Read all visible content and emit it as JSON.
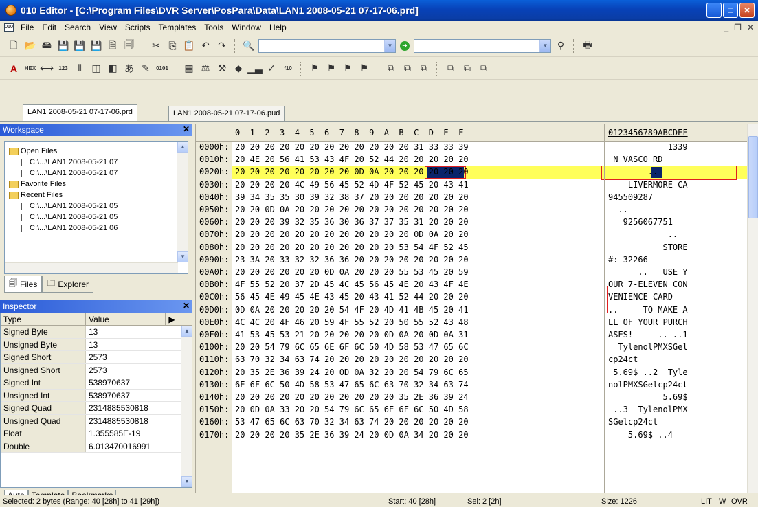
{
  "window": {
    "title": "010 Editor - [C:\\Program Files\\DVR Server\\PosPara\\Data\\LAN1 2008-05-21 07-17-06.prd]"
  },
  "menu": [
    "File",
    "Edit",
    "Search",
    "View",
    "Scripts",
    "Templates",
    "Tools",
    "Window",
    "Help"
  ],
  "toolbar": {
    "icons1": [
      "new-file-icon",
      "open-icon",
      "open-drive-icon",
      "save-icon",
      "save-as-icon",
      "save-all-icon",
      "close-icon",
      "close-all-icon"
    ],
    "icons1b": [
      "cut-icon",
      "copy-icon",
      "paste-icon",
      "undo-icon",
      "redo-icon"
    ],
    "icons1c": [
      "print-icon"
    ],
    "hex_label": "HEX",
    "dec_label": "DEC"
  },
  "file_tabs": [
    "LAN1 2008-05-21 07-17-06.prd",
    "LAN1 2008-05-21 07-17-06.pud"
  ],
  "workspace": {
    "title": "Workspace",
    "tree": [
      {
        "label": "Open Files",
        "type": "folder",
        "indent": 0
      },
      {
        "label": "C:\\...\\LAN1 2008-05-21 07",
        "type": "doc",
        "indent": 1
      },
      {
        "label": "C:\\...\\LAN1 2008-05-21 07",
        "type": "doc",
        "indent": 1
      },
      {
        "label": "Favorite Files",
        "type": "folder",
        "indent": 0
      },
      {
        "label": "Recent Files",
        "type": "folder",
        "indent": 0
      },
      {
        "label": "C:\\...\\LAN1 2008-05-21 05",
        "type": "doc",
        "indent": 1
      },
      {
        "label": "C:\\...\\LAN1 2008-05-21 05",
        "type": "doc",
        "indent": 1
      },
      {
        "label": "C:\\...\\LAN1 2008-05-21 06",
        "type": "doc",
        "indent": 1
      }
    ],
    "tabs": [
      "Files",
      "Explorer"
    ]
  },
  "inspector": {
    "title": "Inspector",
    "col_type": "Type",
    "col_value": "Value",
    "rows": [
      {
        "type": "Signed Byte",
        "value": "13"
      },
      {
        "type": "Unsigned Byte",
        "value": "13"
      },
      {
        "type": "Signed Short",
        "value": "2573"
      },
      {
        "type": "Unsigned Short",
        "value": "2573"
      },
      {
        "type": "Signed Int",
        "value": "538970637"
      },
      {
        "type": "Unsigned Int",
        "value": "538970637"
      },
      {
        "type": "Signed Quad",
        "value": "2314885530818"
      },
      {
        "type": "Unsigned Quad",
        "value": "2314885530818"
      },
      {
        "type": "Float",
        "value": "1.355585E-19"
      },
      {
        "type": "Double",
        "value": "6.013470016991"
      }
    ],
    "tabs": [
      "Auto",
      "Template",
      "Bookmarks"
    ]
  },
  "hex": {
    "header_bytes": "0  1  2  3  4  5  6  7  8  9  A  B  C  D  E  F",
    "header_ascii": "0123456789ABCDEF",
    "rows": [
      {
        "addr": "0000h:",
        "bytes": "20 20 20 20 20 20 20 20 20 20 20 20 31 33 33 39",
        "ascii": "            1339"
      },
      {
        "addr": "0010h:",
        "bytes": "20 4E 20 56 41 53 43 4F 20 52 44 20 20 20 20 20",
        "ascii": " N VASCO RD     "
      },
      {
        "addr": "0020h:",
        "bytes": "20 20 20 20 20 20 20 20 0D 0A 20 20 20 20 20 20",
        "ascii": "        ..      "
      },
      {
        "addr": "0030h:",
        "bytes": "20 20 20 20 4C 49 56 45 52 4D 4F 52 45 20 43 41",
        "ascii": "    LIVERMORE CA"
      },
      {
        "addr": "0040h:",
        "bytes": "39 34 35 35 30 39 32 38 37 20 20 20 20 20 20 20",
        "ascii": "945509287       "
      },
      {
        "addr": "0050h:",
        "bytes": "20 20 0D 0A 20 20 20 20 20 20 20 20 20 20 20 20",
        "ascii": "  ..            "
      },
      {
        "addr": "0060h:",
        "bytes": "20 20 20 39 32 35 36 30 36 37 37 35 31 20 20 20",
        "ascii": "   9256067751   "
      },
      {
        "addr": "0070h:",
        "bytes": "20 20 20 20 20 20 20 20 20 20 20 20 0D 0A 20 20",
        "ascii": "            ..  "
      },
      {
        "addr": "0080h:",
        "bytes": "20 20 20 20 20 20 20 20 20 20 20 53 54 4F 52 45",
        "ascii": "           STORE"
      },
      {
        "addr": "0090h:",
        "bytes": "23 3A 20 33 32 32 36 36 20 20 20 20 20 20 20 20",
        "ascii": "#: 32266        "
      },
      {
        "addr": "00A0h:",
        "bytes": "20 20 20 20 20 20 0D 0A 20 20 20 55 53 45 20 59",
        "ascii": "      ..   USE Y"
      },
      {
        "addr": "00B0h:",
        "bytes": "4F 55 52 20 37 2D 45 4C 45 56 45 4E 20 43 4F 4E",
        "ascii": "OUR 7-ELEVEN CON"
      },
      {
        "addr": "00C0h:",
        "bytes": "56 45 4E 49 45 4E 43 45 20 43 41 52 44 20 20 20",
        "ascii": "VENIENCE CARD   "
      },
      {
        "addr": "00D0h:",
        "bytes": "0D 0A 20 20 20 20 20 54 4F 20 4D 41 4B 45 20 41",
        "ascii": "..     TO MAKE A"
      },
      {
        "addr": "00E0h:",
        "bytes": "4C 4C 20 4F 46 20 59 4F 55 52 20 50 55 52 43 48",
        "ascii": "LL OF YOUR PURCH"
      },
      {
        "addr": "00F0h:",
        "bytes": "41 53 45 53 21 20 20 20 20 20 0D 0A 20 0D 0A 31",
        "ascii": "ASES!     .. ..1"
      },
      {
        "addr": "0100h:",
        "bytes": "20 20 54 79 6C 65 6E 6F 6C 50 4D 58 53 47 65 6C",
        "ascii": "  TylenolPMXSGel"
      },
      {
        "addr": "0110h:",
        "bytes": "63 70 32 34 63 74 20 20 20 20 20 20 20 20 20 20",
        "ascii": "cp24ct          "
      },
      {
        "addr": "0120h:",
        "bytes": "20 35 2E 36 39 24 20 0D 0A 32 20 20 54 79 6C 65",
        "ascii": " 5.69$ ..2  Tyle"
      },
      {
        "addr": "0130h:",
        "bytes": "6E 6F 6C 50 4D 58 53 47 65 6C 63 70 32 34 63 74",
        "ascii": "nolPMXSGelcp24ct"
      },
      {
        "addr": "0140h:",
        "bytes": "20 20 20 20 20 20 20 20 20 20 20 35 2E 36 39 24",
        "ascii": "           5.69$"
      },
      {
        "addr": "0150h:",
        "bytes": "20 0D 0A 33 20 20 54 79 6C 65 6E 6F 6C 50 4D 58",
        "ascii": " ..3  TylenolPMX"
      },
      {
        "addr": "0160h:",
        "bytes": "53 47 65 6C 63 70 32 34 63 74 20 20 20 20 20 20",
        "ascii": "SGelcp24ct      "
      },
      {
        "addr": "0170h:",
        "bytes": "20 20 20 20 35 2E 36 39 24 20 0D 0A 34 20 20 20",
        "ascii": "    5.69$ ..4   "
      }
    ]
  },
  "status": {
    "selected": "Selected: 2 bytes (Range: 40 [28h] to 41 [29h])",
    "start": "Start: 40 [28h]",
    "sel": "Sel: 2 [2h]",
    "size": "Size: 1226",
    "mode_lit": "LIT",
    "mode_w": "W",
    "mode_ovr": "OVR"
  },
  "colors": {
    "highlight_row": "#ffff5a",
    "selection": "#0a246a",
    "annotation_box": "#e02020",
    "titlebar": "#0842b8"
  }
}
